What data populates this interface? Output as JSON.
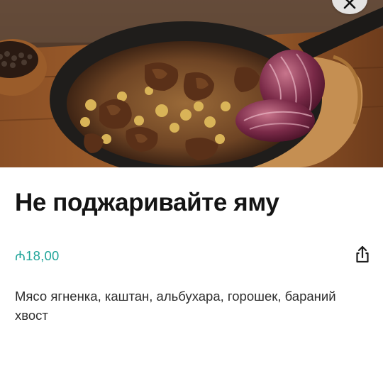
{
  "dish": {
    "title": "Не поджаривайте яму",
    "price": "₼18,00",
    "description": "Мясо ягненка, каштан, альбухара, горошек, бараний хвост"
  },
  "icons": {
    "close": "close-icon",
    "share": "share-icon"
  },
  "colors": {
    "price": "#21a59a",
    "title": "#141414",
    "description": "#2e2e2e"
  }
}
